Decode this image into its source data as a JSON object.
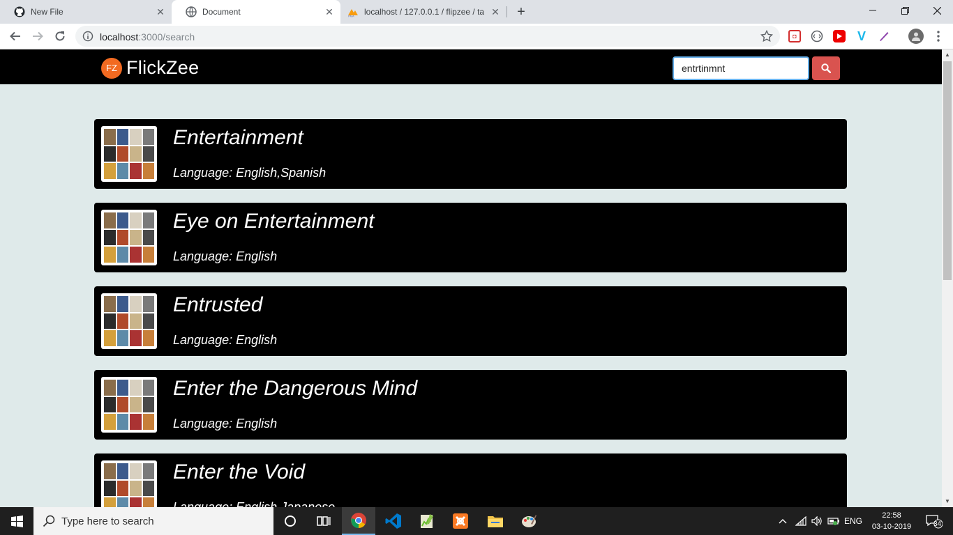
{
  "browser": {
    "tabs": [
      {
        "title": "New File",
        "icon": "github-icon",
        "active": false
      },
      {
        "title": "Document",
        "icon": "globe-icon",
        "active": true
      },
      {
        "title": "localhost / 127.0.0.1 / flipzee / ta",
        "icon": "phpmyadmin-icon",
        "active": false
      }
    ],
    "new_tab_label": "+",
    "close_label": "✕",
    "url_host": "localhost",
    "url_rest": ":3000/search"
  },
  "page": {
    "brand_mark": "FZ",
    "brand_name": "FlickZee",
    "search_value": "entrtinmnt",
    "accent_color": "#d9534f",
    "results": [
      {
        "title": "Entertainment",
        "language": "Language: English,Spanish"
      },
      {
        "title": "Eye on Entertainment",
        "language": "Language: English"
      },
      {
        "title": "Entrusted",
        "language": "Language: English"
      },
      {
        "title": "Enter the Dangerous Mind",
        "language": "Language: English"
      },
      {
        "title": "Enter the Void",
        "language": "Language: English,Japanese"
      }
    ]
  },
  "taskbar": {
    "search_placeholder": "Type here to search",
    "language": "ENG",
    "time": "22:58",
    "date": "03-10-2019",
    "notification_count": "34"
  }
}
